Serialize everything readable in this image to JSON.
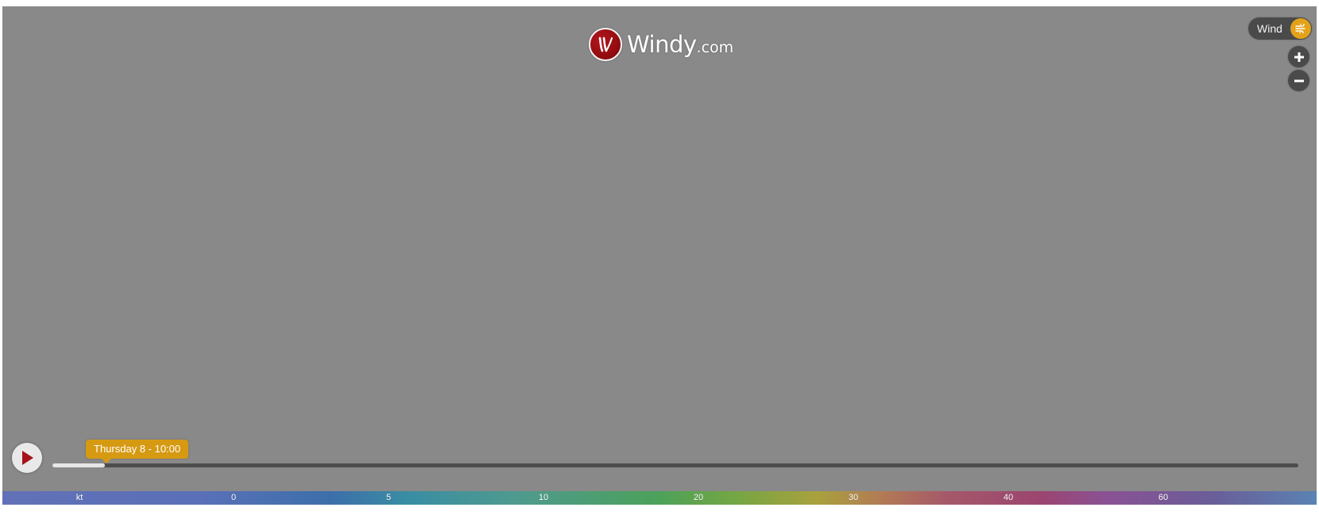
{
  "logo": {
    "brand": "Windy",
    "suffix": ".com"
  },
  "overlay": {
    "label": "Wind",
    "icon": "wind-icon",
    "accent_color": "#e3a21a"
  },
  "zoom": {
    "in_icon": "plus-icon",
    "out_icon": "minus-icon"
  },
  "timeline": {
    "play_icon": "play-icon",
    "current_time": "Thursday 8 - 10:00",
    "progress_fraction": 0.042
  },
  "legend": {
    "unit": "kt",
    "ticks": [
      "0",
      "5",
      "10",
      "20",
      "30",
      "40",
      "60"
    ]
  },
  "colors": {
    "map_background": "#898989",
    "brand_red": "#9a1015",
    "time_bubble": "#d69a12"
  }
}
